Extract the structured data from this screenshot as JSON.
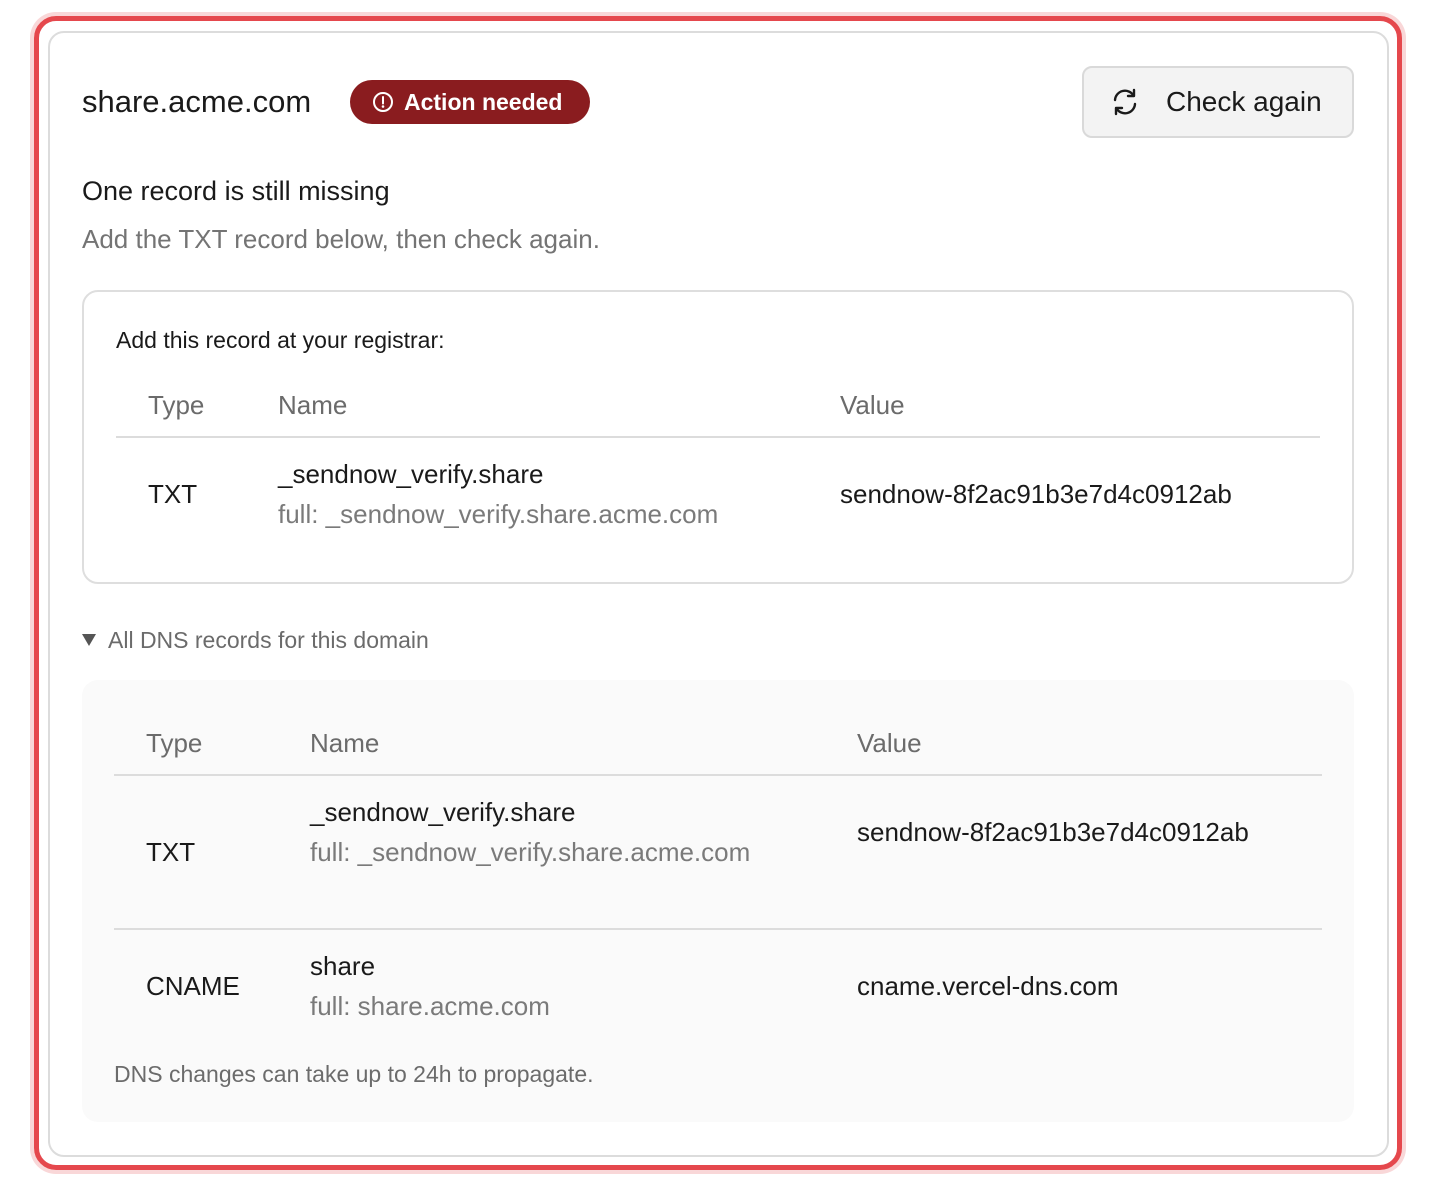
{
  "header": {
    "domain": "share.acme.com",
    "status_badge": "Action needed",
    "check_button": "Check again"
  },
  "status": {
    "title": "One record is still missing",
    "subtitle": "Add the TXT record below, then check again."
  },
  "required_record": {
    "heading": "Add this record at your registrar:",
    "columns": [
      "Type",
      "Name",
      "Value"
    ],
    "row": {
      "type": "TXT",
      "name": "_sendnow_verify.share",
      "full": "full: _sendnow_verify.share.acme.com",
      "value": "sendnow-8f2ac91b3e7d4c0912ab"
    }
  },
  "all_records": {
    "toggle_label": "All DNS records for this domain",
    "columns": [
      "Type",
      "Name",
      "Value"
    ],
    "rows": [
      {
        "type": "TXT",
        "name": "_sendnow_verify.share",
        "full": "full: _sendnow_verify.share.acme.com",
        "value": "sendnow-8f2ac91b3e7d4c0912ab"
      },
      {
        "type": "CNAME",
        "name": "share",
        "full": "full: share.acme.com",
        "value": "cname.vercel-dns.com"
      }
    ],
    "note": "DNS changes can take up to 24h to propagate."
  },
  "colors": {
    "alert_border": "#e5484d",
    "badge_bg": "#8a1c1f"
  },
  "icons": {
    "badge": "alert-circle-icon",
    "button": "refresh-icon",
    "toggle": "triangle-down-icon"
  }
}
